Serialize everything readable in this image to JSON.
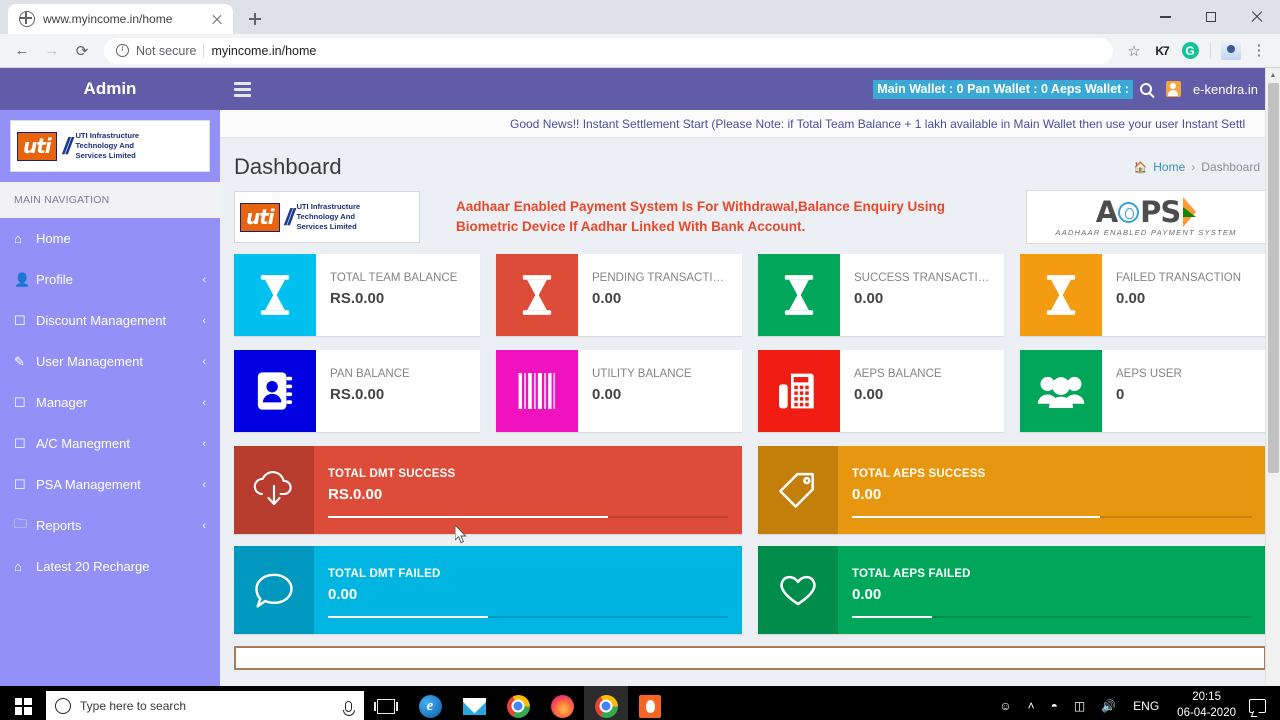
{
  "browser": {
    "tab_title": "www.myincome.in/home",
    "favicon": "globe-icon",
    "new_tab_label": "+",
    "security_label": "Not secure",
    "url": "myincome.in/home",
    "back_glyph": "←",
    "forward_glyph": "→",
    "reload_glyph": "⟳",
    "star_glyph": "☆",
    "k7_label": "K7",
    "grammarly_label": "G",
    "kebab_glyph": "⋮"
  },
  "app": {
    "brand": "Admin",
    "menu_toggle": "hamburger-icon",
    "wallets": "Main Wallet : 0  Pan Wallet : 0  Aeps Wallet :",
    "user_name": "e-kendra.in",
    "marquee": "Good News!! Instant Settlement Start (Please Note: if Total Team Balance + 1 lakh available in Main Wallet then use your user Instant Settl",
    "page_title": "Dashboard",
    "breadcrumb": {
      "home": "Home",
      "separator": "›",
      "current": "Dashboard"
    }
  },
  "sidebar": {
    "logo": {
      "mark": "uti",
      "line1": "UTI Infrastructure",
      "line2": "Technology And",
      "line3": "Services Limited"
    },
    "section_label": "MAIN NAVIGATION",
    "caret": "‹",
    "items": [
      {
        "label": "Home",
        "icon": "home-icon",
        "glyph": "⌂",
        "has_caret": false
      },
      {
        "label": "Profile",
        "icon": "user-icon",
        "glyph": "👤",
        "has_caret": true
      },
      {
        "label": "Discount Management",
        "icon": "monitor-icon",
        "glyph": "☐",
        "has_caret": true
      },
      {
        "label": "User Management",
        "icon": "edit-icon",
        "glyph": "✎",
        "has_caret": true
      },
      {
        "label": "Manager",
        "icon": "monitor-icon",
        "glyph": "☐",
        "has_caret": true
      },
      {
        "label": "A/C Manegment",
        "icon": "monitor-icon",
        "glyph": "☐",
        "has_caret": true
      },
      {
        "label": "PSA Management",
        "icon": "monitor-icon",
        "glyph": "☐",
        "has_caret": true
      },
      {
        "label": "Reports",
        "icon": "folder-icon",
        "glyph": "🗀",
        "has_caret": true
      },
      {
        "label": "Latest 20 Recharge",
        "icon": "home-icon",
        "glyph": "⌂",
        "has_caret": false
      }
    ]
  },
  "banner": {
    "uti_logo": {
      "mark": "uti",
      "line1": "UTI Infrastructure",
      "line2": "Technology And",
      "line3": "Services Limited"
    },
    "message": "Aadhaar Enabled Payment System Is For Withdrawal,Balance Enquiry Using Biometric Device If Aadhar Linked With Bank Account.",
    "message_color": "#e8492a",
    "aeps_logo": {
      "text_a": "A",
      "text_ps": "PS",
      "subtitle": "AADHAAR ENABLED PAYMENT SYSTEM"
    }
  },
  "info_boxes": [
    {
      "label": "TOTAL TEAM BALANCE",
      "value": "RS.0.00",
      "color": "#00c0ef",
      "icon": "hourglass-icon"
    },
    {
      "label": "PENDING TRANSACTI…",
      "value": "0.00",
      "color": "#dd4b39",
      "icon": "hourglass-icon"
    },
    {
      "label": "SUCCESS TRANSACTI…",
      "value": "0.00",
      "color": "#00a65a",
      "icon": "hourglass-icon"
    },
    {
      "label": "FAILED TRANSACTION",
      "value": "0.00",
      "color": "#f39c12",
      "icon": "hourglass-icon"
    },
    {
      "label": "PAN BALANCE",
      "value": "RS.0.00",
      "color": "#0000e0",
      "icon": "address-book-icon"
    },
    {
      "label": "UTILITY BALANCE",
      "value": "0.00",
      "color": "#f012be",
      "icon": "barcode-icon"
    },
    {
      "label": "AEPS BALANCE",
      "value": "0.00",
      "color": "#f01e12",
      "icon": "fax-icon"
    },
    {
      "label": "AEPS USER",
      "value": "0",
      "color": "#00a65a",
      "icon": "users-icon"
    }
  ],
  "big_boxes": [
    {
      "title": "TOTAL DMT SUCCESS",
      "value": "RS.0.00",
      "color": "#dd4b39",
      "icon_bg": "#b93d2f",
      "icon": "cloud-download-icon",
      "progress": 70
    },
    {
      "title": "TOTAL AEPS SUCCESS",
      "value": "0.00",
      "color": "#e7960f",
      "icon_bg": "#c47f0b",
      "icon": "tag-icon",
      "progress": 62
    },
    {
      "title": "TOTAL DMT FAILED",
      "value": "0.00",
      "color": "#00b5e2",
      "icon_bg": "#0098bf",
      "icon": "comment-icon",
      "progress": 40
    },
    {
      "title": "TOTAL AEPS FAILED",
      "value": "0.00",
      "color": "#00a65a",
      "icon_bg": "#008d4c",
      "icon": "heart-icon",
      "progress": 20
    }
  ],
  "taskbar": {
    "start_label": "start-icon",
    "search_placeholder": "Type here to search",
    "apps": [
      {
        "name": "task-view-icon"
      },
      {
        "name": "edge-icon",
        "label": "e"
      },
      {
        "name": "mail-icon"
      },
      {
        "name": "chrome-icon"
      },
      {
        "name": "firefox-icon"
      },
      {
        "name": "chrome-active-icon"
      },
      {
        "name": "orange-app-icon"
      }
    ],
    "tray": {
      "people_glyph": "ღ",
      "chevron_glyph": "˄",
      "wifi_glyph": "◠",
      "battery_glyph": "▭",
      "volume_glyph": "ᴴ",
      "language": "ENG",
      "time": "20:15",
      "date": "06-04-2020"
    }
  }
}
